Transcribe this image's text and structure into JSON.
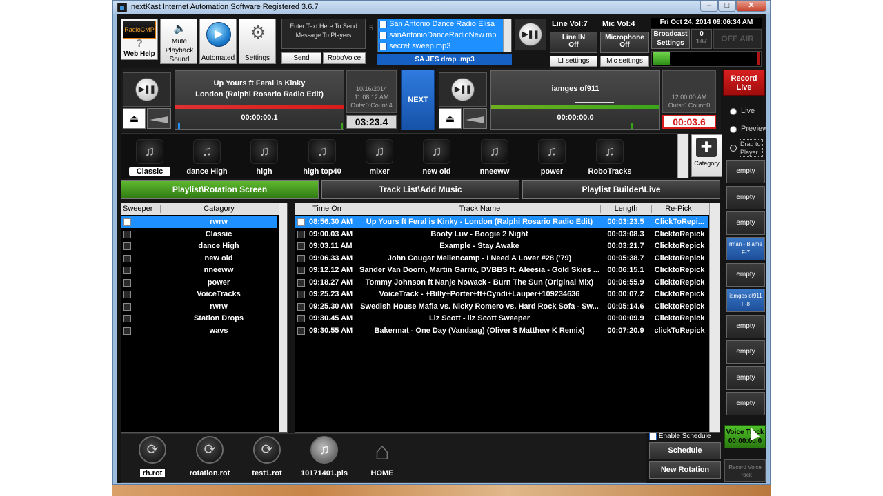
{
  "window": {
    "title": "nextKast Internet Automation Software Registered 3.6.7",
    "min": "–",
    "max": "□",
    "close": "✕"
  },
  "toolbar": {
    "radiocmp": "RadioCMP",
    "web_help": "Web Help",
    "mute_label": "Mute Playback Sound",
    "automated": "Automated",
    "settings": "Settings",
    "message_hint": "Enter Text Here To Send Message To Players",
    "send": "Send",
    "robovoice": "RoboVoice",
    "queue_number": "5",
    "queue_items": [
      "San Antonio Dance Radio Elisa",
      "sanAntonioDanceRadioNew.mp",
      "secret sweep.mp3"
    ],
    "queue_selected": "SA JES drop .mp3"
  },
  "levels": {
    "line_vol": "Line Vol:7",
    "mic_vol": "Mic Vol:4",
    "line_in": "Line IN",
    "line_in_state": "Off",
    "microphone": "Microphone",
    "microphone_state": "Off",
    "li_settings": "LI settings",
    "mic_settings": "Mic settings"
  },
  "status": {
    "datetime": "Fri Oct 24, 2014  09:06:34 AM",
    "broadcast": "Broadcast Settings",
    "count_a": "0",
    "count_b": "147",
    "off_air": "OFF AIR",
    "record_live": "Record Live"
  },
  "player_a": {
    "line1": "Up Yours ft Feral is Kinky",
    "line2": "London (Ralphi Rosario Radio Edit)",
    "time": "00:00:00.1",
    "date": "10/16/2014",
    "clock": "11:08:12 AM",
    "outs": "Outs:0 Count:4",
    "remaining": "03:23.4",
    "play_glyph": "▶❚❚"
  },
  "next_label": "NEXT",
  "player_b": {
    "line1": "iamges of911",
    "time": "00:00:00.0",
    "clock": "12:00:00 AM",
    "outs": "Outs:0 Count:0",
    "remaining": "00:03.6",
    "play_glyph": "▶❚❚"
  },
  "categories": {
    "items": [
      "Classic",
      "dance High",
      "high",
      "high top40",
      "mixer",
      "new old",
      "nneeww",
      "power",
      "RoboTracks"
    ],
    "add_label": "Category",
    "add_glyph": "✚",
    "note_glyph": "♫"
  },
  "tabs": [
    "Playlist\\Rotation Screen",
    "Track List\\Add Music",
    "Playlist Builder\\Live"
  ],
  "sweeper_table": {
    "headers": [
      "Sweeper",
      "Catagory"
    ],
    "rows": [
      "rwrw",
      "Classic",
      "dance High",
      "new old",
      "nneeww",
      "power",
      "VoiceTracks",
      "rwrw",
      "Station Drops",
      "wavs"
    ]
  },
  "track_table": {
    "headers": [
      "Time On",
      "Track Name",
      "Length",
      "Re-Pick"
    ],
    "rows": [
      {
        "time": "08:56.30 AM",
        "name": "Up Yours ft Feral is Kinky - London (Ralphi Rosario Radio Edit)",
        "length": "00:03:23.5",
        "repick": "ClickToRepi..."
      },
      {
        "time": "09:00.03 AM",
        "name": "Booty Luv - Boogie 2 Night",
        "length": "00:03:08.3",
        "repick": "ClicktoRepick"
      },
      {
        "time": "09:03.11 AM",
        "name": "Example - Stay Awake",
        "length": "00:03:21.7",
        "repick": "ClicktoRepick"
      },
      {
        "time": "09:06.33 AM",
        "name": "John Cougar Mellencamp - I Need A Lover    #28  ('79)",
        "length": "00:05:38.7",
        "repick": "ClicktoRepick"
      },
      {
        "time": "09:12.12 AM",
        "name": "Sander Van Doorn, Martin Garrix, DVBBS ft. Aleesia - Gold Skies ...",
        "length": "00:06:15.1",
        "repick": "ClicktoRepick"
      },
      {
        "time": "09:18.27 AM",
        "name": "Tommy Johnson ft Nanje Nowack - Burn The Sun (Original Mix)",
        "length": "00:06:55.9",
        "repick": "ClicktoRepick"
      },
      {
        "time": "09:25.23 AM",
        "name": "VoiceTrack - +Billy+Porter+ft+Cyndi+Lauper+109234636",
        "length": "00:00:07.2",
        "repick": "ClicktoRepick"
      },
      {
        "time": "09:25.30 AM",
        "name": "Swedish House Mafia vs. Nicky Romero vs. Hard Rock Sofa - Sw...",
        "length": "00:05:14.6",
        "repick": "ClicktoRepick"
      },
      {
        "time": "09:30.45 AM",
        "name": "Liz Scott - liz Scott Sweeper",
        "length": "00:00:09.9",
        "repick": "ClicktoRepick"
      },
      {
        "time": "09:30.55 AM",
        "name": "Bakermat - One Day (Vandaag) (Oliver $ Matthew K Remix)",
        "length": "00:07:20.9",
        "repick": "clickToRepick"
      }
    ]
  },
  "right_panel": {
    "live": "Live",
    "preview": "Preview",
    "drag": "Drag to Player",
    "slots": [
      "empty",
      "empty",
      "empty",
      "rman - Blame\nF-7",
      "empty",
      "iamges of911\nF-8",
      "empty",
      "empty",
      "empty",
      "empty"
    ],
    "voice_track": "Voice Track",
    "voice_time": "00:00:00.0",
    "record_voice": "Record Voice Track"
  },
  "rotations": {
    "items": [
      "rh.rot",
      "rotation.rot",
      "test1.rot",
      "10171401.pls",
      "HOME"
    ],
    "enable_schedule": "Enable Schedule",
    "schedule": "Schedule",
    "new_rotation": "New Rotation"
  },
  "colors": {
    "accent_blue": "#1e90ff",
    "green": "#3aa51a",
    "red": "#d81c1c"
  }
}
